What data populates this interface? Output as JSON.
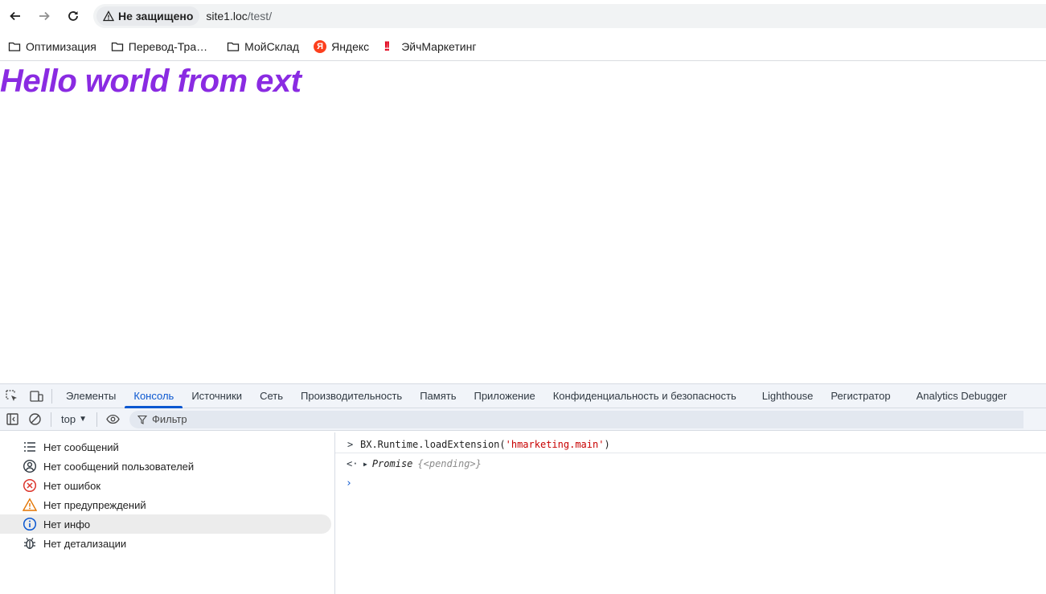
{
  "browser": {
    "security_label": "Не защищено",
    "url_host": "site1.loc",
    "url_path": "/test/",
    "bookmarks": [
      {
        "label": "Оптимизация",
        "icon": "folder-icon"
      },
      {
        "label": "Перевод-Тра…",
        "icon": "folder-icon"
      },
      {
        "label": "МойСклад",
        "icon": "folder-icon"
      },
      {
        "label": "Яндекс",
        "icon": "yandex-icon"
      },
      {
        "label": "ЭйчМаркетинг",
        "icon": "hmarketing-icon"
      }
    ],
    "yandex_glyph": "Я"
  },
  "page": {
    "heading": "Hello world from ext",
    "heading_color": "#8a2be2"
  },
  "devtools": {
    "tabs": [
      {
        "label": "Элементы"
      },
      {
        "label": "Консоль",
        "active": true
      },
      {
        "label": "Источники"
      },
      {
        "label": "Сеть"
      },
      {
        "label": "Производительность"
      },
      {
        "label": "Память"
      },
      {
        "label": "Приложение"
      },
      {
        "label": "Конфиденциальность и безопасность"
      },
      {
        "label": "Lighthouse"
      },
      {
        "label": "Регистратор"
      },
      {
        "label": "Analytics Debugger"
      }
    ],
    "context": "top",
    "filter_placeholder": "Фильтр",
    "sidebar": [
      {
        "label": "Нет сообщений",
        "icon": "list-icon"
      },
      {
        "label": "Нет сообщений пользователей",
        "icon": "user-icon"
      },
      {
        "label": "Нет ошибок",
        "icon": "error-icon"
      },
      {
        "label": "Нет предупреждений",
        "icon": "warning-icon"
      },
      {
        "label": "Нет инфо",
        "icon": "info-icon",
        "selected": true
      },
      {
        "label": "Нет детализации",
        "icon": "bug-icon"
      }
    ],
    "console": {
      "input_code_prefix": "BX.Runtime.loadExtension(",
      "input_code_string": "'hmarketing.main'",
      "input_code_suffix": ")",
      "result_label": "Promise",
      "result_state": "{<pending>}"
    }
  }
}
